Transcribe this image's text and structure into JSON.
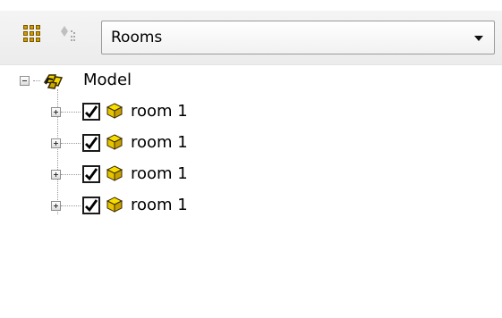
{
  "toolbar": {
    "filter_select": {
      "selected": "Rooms"
    },
    "icons": [
      "grid-icon",
      "filter-icon",
      "chevron-down-icon"
    ]
  },
  "tree": {
    "root": {
      "label": "Model",
      "expanded": true,
      "icon": "model-icon"
    },
    "items": [
      {
        "label": "room 1",
        "checked": true,
        "expanded": false,
        "icon": "room-icon"
      },
      {
        "label": "room 1",
        "checked": true,
        "expanded": false,
        "icon": "room-icon"
      },
      {
        "label": "room 1",
        "checked": true,
        "expanded": false,
        "icon": "room-icon"
      },
      {
        "label": "room 1",
        "checked": true,
        "expanded": false,
        "icon": "room-icon"
      }
    ]
  },
  "colors": {
    "toolbar_bg": "#efefef",
    "room_icon": "#e7c400",
    "model_icon": "#f0d000"
  }
}
